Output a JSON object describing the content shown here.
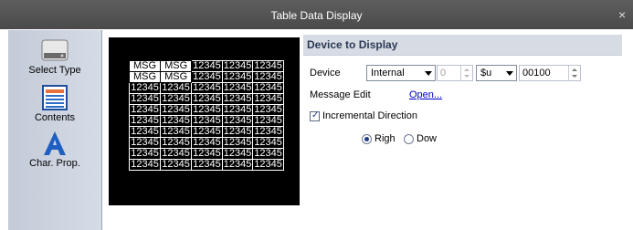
{
  "window": {
    "title": "Table Data Display",
    "close_glyph": "×"
  },
  "sidebar": {
    "items": [
      {
        "label": "Select Type",
        "icon": "device-icon"
      },
      {
        "label": "Contents",
        "icon": "contents-icon"
      },
      {
        "label": "Char. Prop.",
        "icon": "letter-a-icon"
      }
    ]
  },
  "preview": {
    "rows": [
      [
        "MSG",
        "MSG",
        "12345",
        "12345",
        "12345"
      ],
      [
        "MSG",
        "MSG",
        "12345",
        "12345",
        "12345"
      ],
      [
        "12345",
        "12345",
        "12345",
        "12345",
        "12345"
      ],
      [
        "12345",
        "12345",
        "12345",
        "12345",
        "12345"
      ],
      [
        "12345",
        "12345",
        "12345",
        "12345",
        "12345"
      ],
      [
        "12345",
        "12345",
        "12345",
        "12345",
        "12345"
      ],
      [
        "12345",
        "12345",
        "12345",
        "12345",
        "12345"
      ],
      [
        "12345",
        "12345",
        "12345",
        "12345",
        "12345"
      ],
      [
        "12345",
        "12345",
        "12345",
        "12345",
        "12345"
      ],
      [
        "12345",
        "12345",
        "12345",
        "12345",
        "12345"
      ]
    ]
  },
  "panel": {
    "section_title": "Device to Display",
    "device_label": "Device",
    "device_type": "Internal",
    "device_number": "0",
    "device_prefix": "$u",
    "device_address": "00100",
    "message_edit_label": "Message Edit",
    "open_link": "Open...",
    "incremental_label": "Incremental Direction",
    "incremental_checked": true,
    "direction_right": "Righ",
    "direction_down": "Dow",
    "direction_selected": "right"
  },
  "colors": {
    "titlebar": "#4a4a4a",
    "sidebar": "#c9d0dc",
    "section_header": "#d7dce4",
    "link": "#0000cc"
  }
}
